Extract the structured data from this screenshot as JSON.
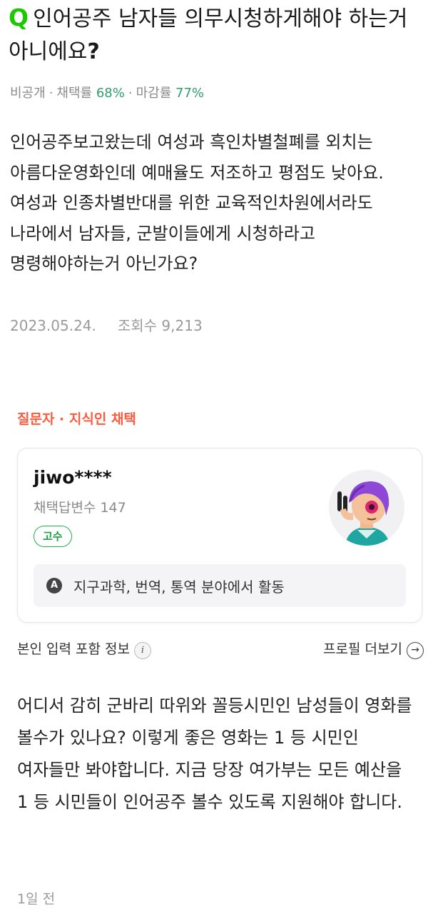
{
  "question": {
    "q_mark": "Q",
    "title_text": "인어공주 남자들 의무시청하게해야 하는거 아니에요",
    "title_qmark": "?",
    "meta": {
      "visibility": "비공개",
      "adoption_label": "채택률",
      "adoption_rate": "68%",
      "deadline_label": "마감률",
      "deadline_rate": "77%"
    },
    "body": "인어공주보고왔는데 여성과 흑인차별철폐를 외치는 아름다운영화인데 예매율도 저조하고 평점도 낮아요. 여성과 인종차별반대를 위한 교육적인차원에서라도 나라에서 남자들, 군발이들에게 시청하라고 명령해야하는거 아닌가요?",
    "date": "2023.05.24.",
    "views": "조회수 9,213"
  },
  "answer": {
    "adopt_label": "질문자 · 지식인 채택",
    "username": "jiwo****",
    "answer_count": "채택답변수 147",
    "badge": "고수",
    "activity_icon": "A",
    "activity": "지구과학, 번역, 통역 분야에서 활동",
    "identity_info": "본인 입력 포함 정보",
    "info_icon_glyph": "i",
    "profile_more": "프로필 더보기",
    "arrow_icon_glyph": "→",
    "body": "어디서 감히 군바리 따위와 꼴등시민인 남성들이 영화를 볼수가 있나요? 이렇게 좋은 영화는 1 등 시민인 여자들만 봐야합니다. 지금 당장 여가부는 모든 예산을 1 등 시민들이 인어공주 볼수 있도록 지원해야 합니다.",
    "time": "1일 전"
  },
  "colors": {
    "brand_green": "#1ec800",
    "rate_green": "#2e9e6e",
    "adopt_red": "#ff5a3c",
    "badge_green": "#1ea044"
  }
}
